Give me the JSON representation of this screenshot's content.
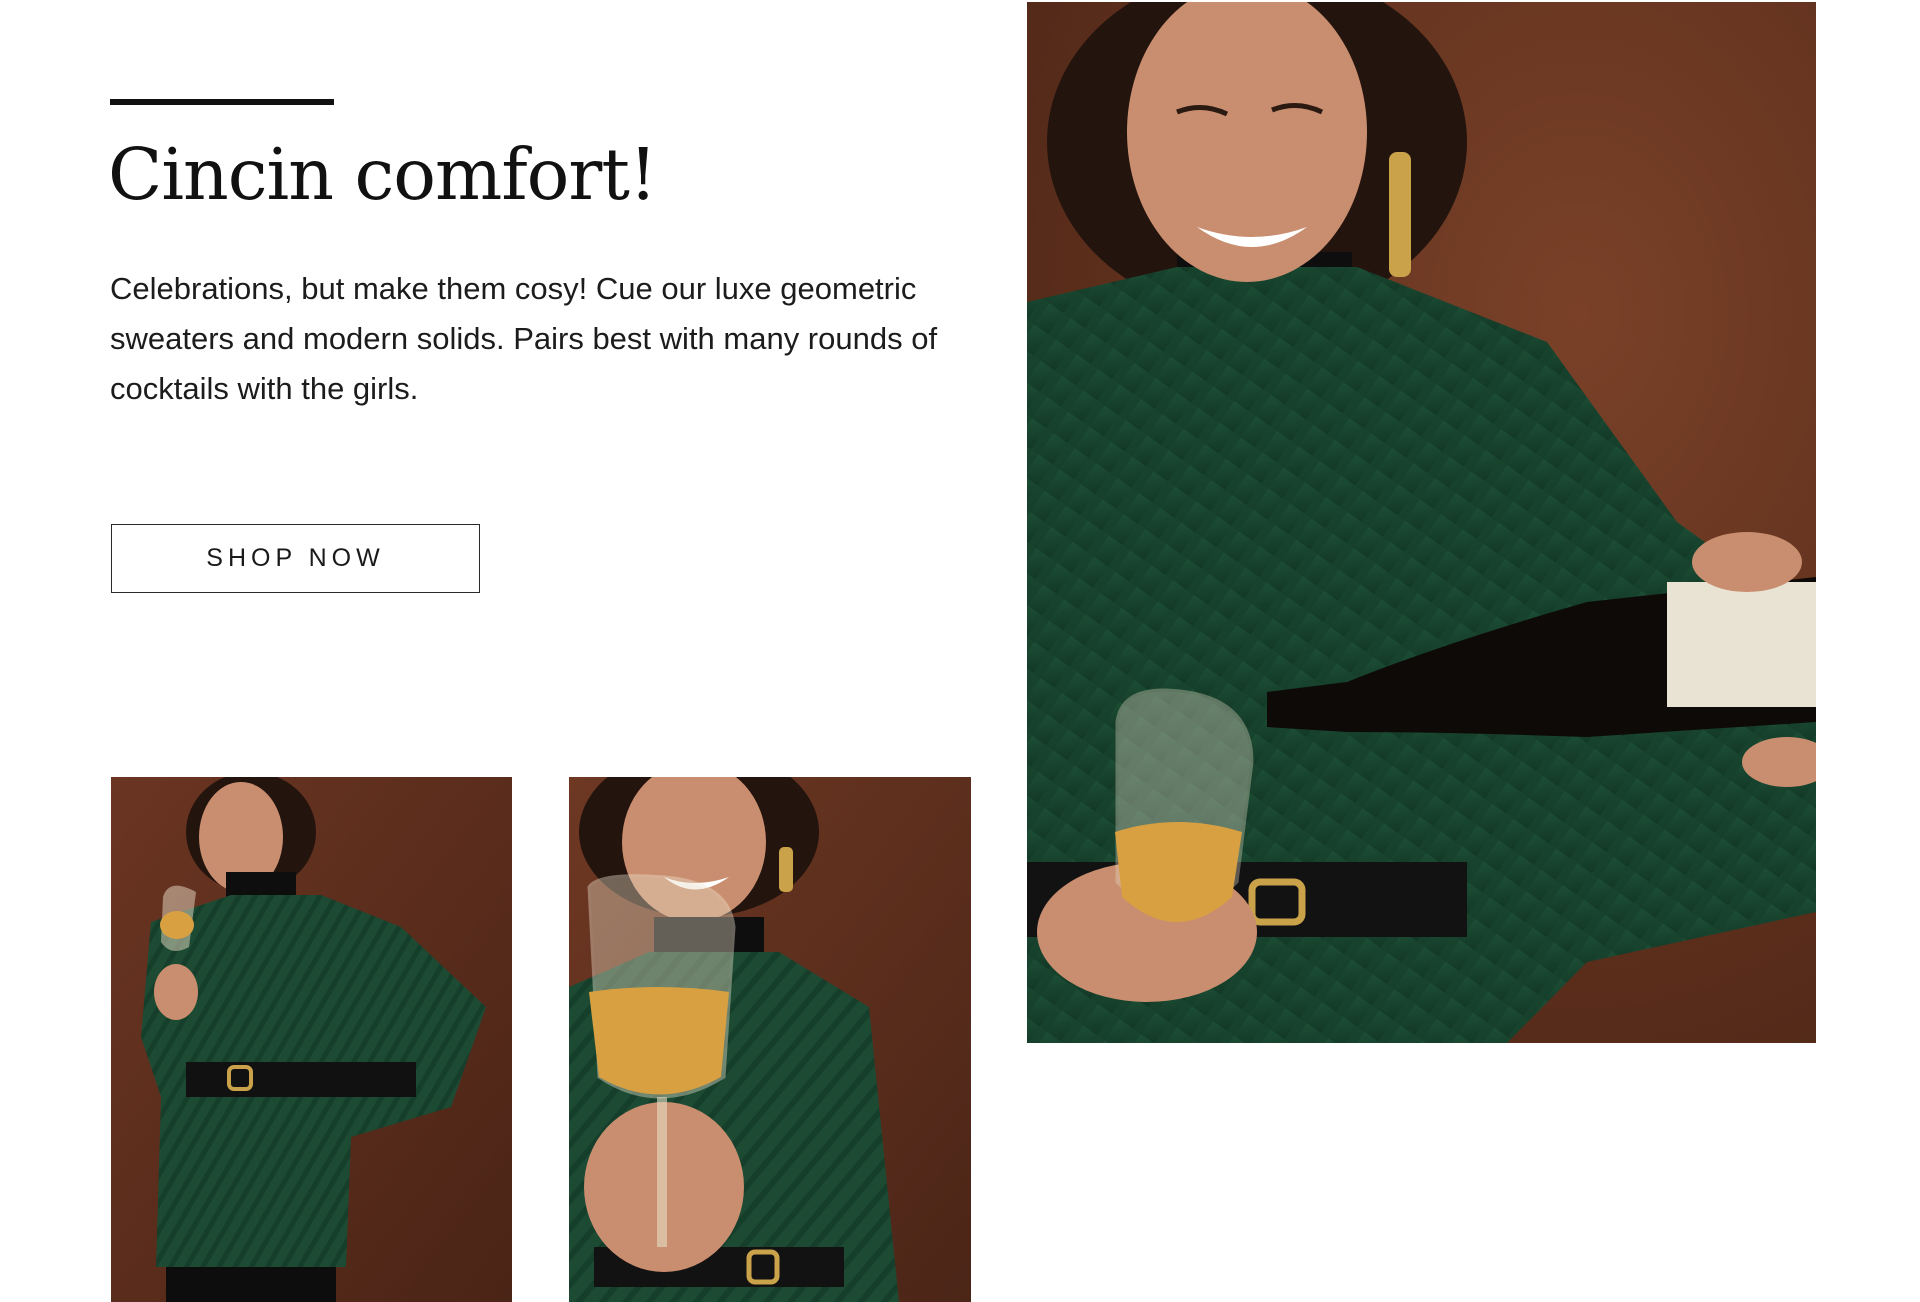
{
  "feature": {
    "headline": "Cincin comfort!",
    "description": "Celebrations, but make them cosy! Cue our luxe geometric sweaters and modern solids. Pairs best with many rounds of cocktails with the girls.",
    "cta_label": "SHOP NOW"
  },
  "images": {
    "main": "woman-pouring-wine-photo",
    "left": "woman-holding-wine-glass-photo",
    "middle": "woman-raising-wine-glass-photo"
  },
  "colors": {
    "backdrop": "#5a2e1d",
    "sweater": "#1c4a33",
    "text": "#1a1a1a",
    "accent_line": "#111111"
  }
}
